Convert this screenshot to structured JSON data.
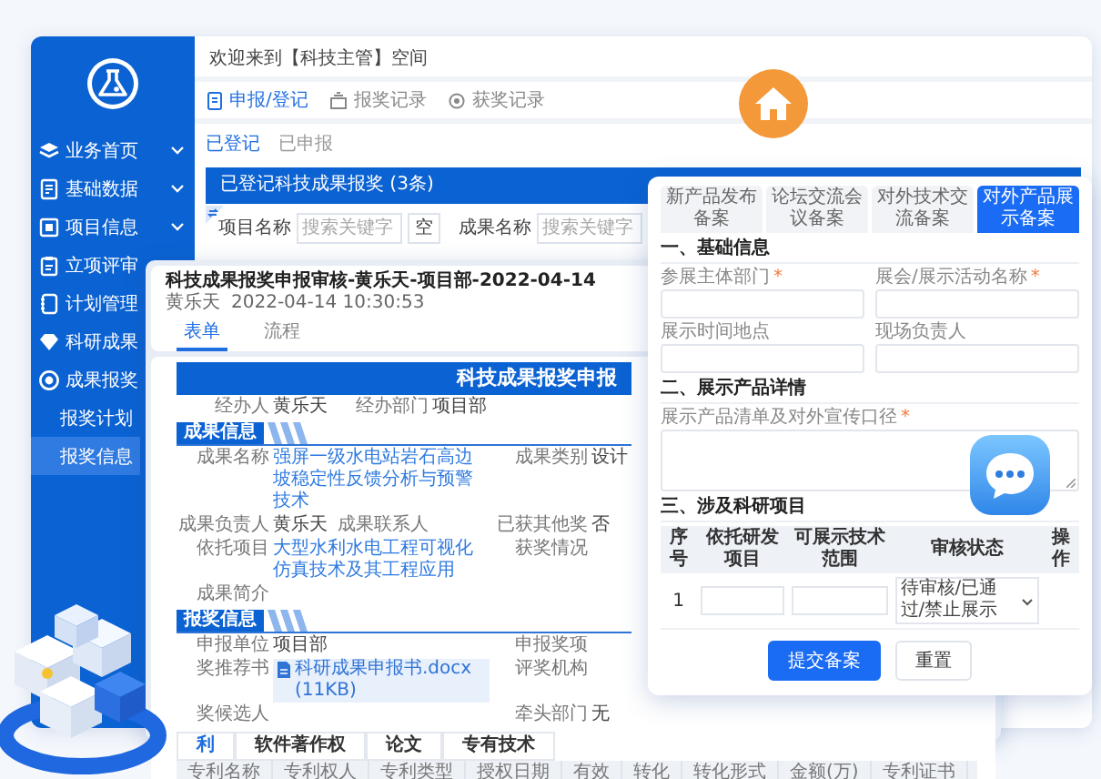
{
  "main_window": {
    "welcome": "欢迎来到【科技主管】空间",
    "sidebar": {
      "items": [
        {
          "label": "业务首页",
          "kind": "menu",
          "selected": false
        },
        {
          "label": "基础数据",
          "kind": "menu",
          "selected": false
        },
        {
          "label": "项目信息",
          "kind": "menu",
          "selected": false
        },
        {
          "label": "立项评审",
          "kind": "link",
          "selected": false
        },
        {
          "label": "计划管理",
          "kind": "link",
          "selected": false
        },
        {
          "label": "科研成果",
          "kind": "link",
          "selected": false
        },
        {
          "label": "成果报奖",
          "kind": "group",
          "selected": false,
          "children": [
            {
              "label": "报奖计划",
              "selected": false
            },
            {
              "label": "报奖信息",
              "selected": true
            }
          ]
        }
      ]
    },
    "tabs": [
      {
        "label": "申报/登记",
        "selected": true
      },
      {
        "label": "报奖记录",
        "selected": false
      },
      {
        "label": "获奖记录",
        "selected": false
      }
    ],
    "subtabs": [
      {
        "label": "已登记",
        "selected": true
      },
      {
        "label": "已申报",
        "selected": false
      }
    ],
    "panel_title": "已登记科技成果报奖 (3条)",
    "filters": [
      {
        "label": "项目名称",
        "placeholder": "搜索关键字",
        "button": "空"
      },
      {
        "label": "成果名称",
        "placeholder": "搜索关键字"
      }
    ]
  },
  "review_window": {
    "title": "科技成果报奖申报审核-黄乐天-项目部-2022-04-14",
    "author": "黄乐天",
    "time": "2022-04-14 10:30:53",
    "tabs": [
      {
        "label": "表单",
        "selected": true
      },
      {
        "label": "流程",
        "selected": false
      }
    ],
    "banner": "科技成果报奖申报",
    "top_row": {
      "left": {
        "label": "经办人",
        "value": "黄乐天"
      },
      "middle": {
        "label": "经办部门",
        "value": "项目部"
      }
    },
    "sections": [
      {
        "title": "成果信息",
        "rows": [
          {
            "left": {
              "label": "成果名称",
              "value": "强屏一级水电站岩石高边坡稳定性反馈分析与预警技术",
              "kind": "link"
            },
            "right": {
              "label": "成果类别",
              "value": "设计"
            }
          },
          {
            "left": {
              "label": "成果负责人",
              "value": "黄乐天"
            },
            "middle": {
              "label": "成果联系人"
            },
            "right": {
              "label": "已获其他奖",
              "value": "否"
            }
          },
          {
            "left": {
              "label": "依托项目",
              "value": "大型水利水电工程可视化仿真技术及其工程应用",
              "kind": "link"
            },
            "right": {
              "label": "获奖情况"
            }
          },
          {
            "left": {
              "label": "成果简介"
            }
          }
        ]
      },
      {
        "title": "报奖信息",
        "rows": [
          {
            "left": {
              "label": "申报单位",
              "value": "项目部"
            },
            "right": {
              "label": "申报奖项"
            }
          },
          {
            "left": {
              "label": "奖推荐书",
              "value": "科研成果申报书.docx (11KB)",
              "kind": "file"
            },
            "right": {
              "label": "评奖机构"
            }
          },
          {
            "left": {
              "label": "奖候选人"
            },
            "right": {
              "label": "牵头部门",
              "value": "无"
            }
          }
        ]
      }
    ],
    "bottom_tabs": [
      {
        "label": "利",
        "selected": true
      },
      {
        "label": "软件著作权",
        "selected": false
      },
      {
        "label": "论文",
        "selected": false
      },
      {
        "label": "专有技术",
        "selected": false
      }
    ],
    "table_columns": [
      "专利名称",
      "专利权人",
      "专利类型",
      "授权日期",
      "有效",
      "转化",
      "转化形式",
      "金额(万)",
      "专利证书"
    ]
  },
  "form_window": {
    "tabs": [
      {
        "label": "新产品发布备案",
        "selected": false
      },
      {
        "label": "论坛交流会议备案",
        "selected": false
      },
      {
        "label": "对外技术交流备案",
        "selected": false
      },
      {
        "label": "对外产品展示备案",
        "selected": true
      }
    ],
    "sections": [
      {
        "title": "一、基础信息",
        "fields": [
          {
            "label": "参展主体部门",
            "required_mark": "*",
            "kind": "input"
          },
          {
            "label": "展会/展示活动名称",
            "required_mark": "*",
            "kind": "input"
          },
          {
            "label": "展示时间地点",
            "kind": "input"
          },
          {
            "label": "现场负责人",
            "kind": "input"
          }
        ]
      },
      {
        "title": "二、展示产品详情",
        "fields": [
          {
            "label": "展示产品清单及对外宣传口径",
            "required_mark": "*",
            "kind": "textarea"
          }
        ]
      },
      {
        "title": "三、涉及科研项目",
        "table": {
          "columns": [
            "序号",
            "依托研发项目",
            "可展示技术范围",
            "审核状态",
            "操作"
          ],
          "rows": [
            {
              "index": "1",
              "status": "待审核/已通过/禁止展示"
            }
          ]
        }
      }
    ],
    "buttons": [
      {
        "label": "提交备案",
        "kind": "primary"
      },
      {
        "label": "重置",
        "kind": "plain"
      }
    ]
  }
}
